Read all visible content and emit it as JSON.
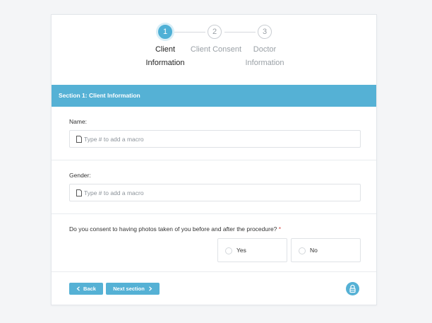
{
  "stepper": {
    "steps": [
      {
        "number": "1",
        "label_line1": "Client",
        "label_line2": "Information"
      },
      {
        "number": "2",
        "label_line1": "Client Consent",
        "label_line2": ""
      },
      {
        "number": "3",
        "label_line1": "Doctor",
        "label_line2": "Information"
      }
    ],
    "active_step": 1
  },
  "section": {
    "title": "Section 1: Client Information"
  },
  "fields": {
    "name": {
      "label": "Name:",
      "placeholder": "Type # to add a macro",
      "value": ""
    },
    "gender": {
      "label": "Gender:",
      "placeholder": "Type # to add a macro",
      "value": ""
    }
  },
  "consent": {
    "question": "Do you consent to having photos taken of you before and after the procedure?",
    "required_marker": "*",
    "options": [
      "Yes",
      "No"
    ],
    "selected": null
  },
  "footer": {
    "back_label": "Back",
    "next_label": "Next section"
  },
  "colors": {
    "accent": "#55b1d5",
    "required": "#d64541"
  },
  "icons": {
    "field": "document-icon",
    "back": "chevron-left-icon",
    "next": "chevron-right-icon",
    "lock": "lock-icon"
  }
}
